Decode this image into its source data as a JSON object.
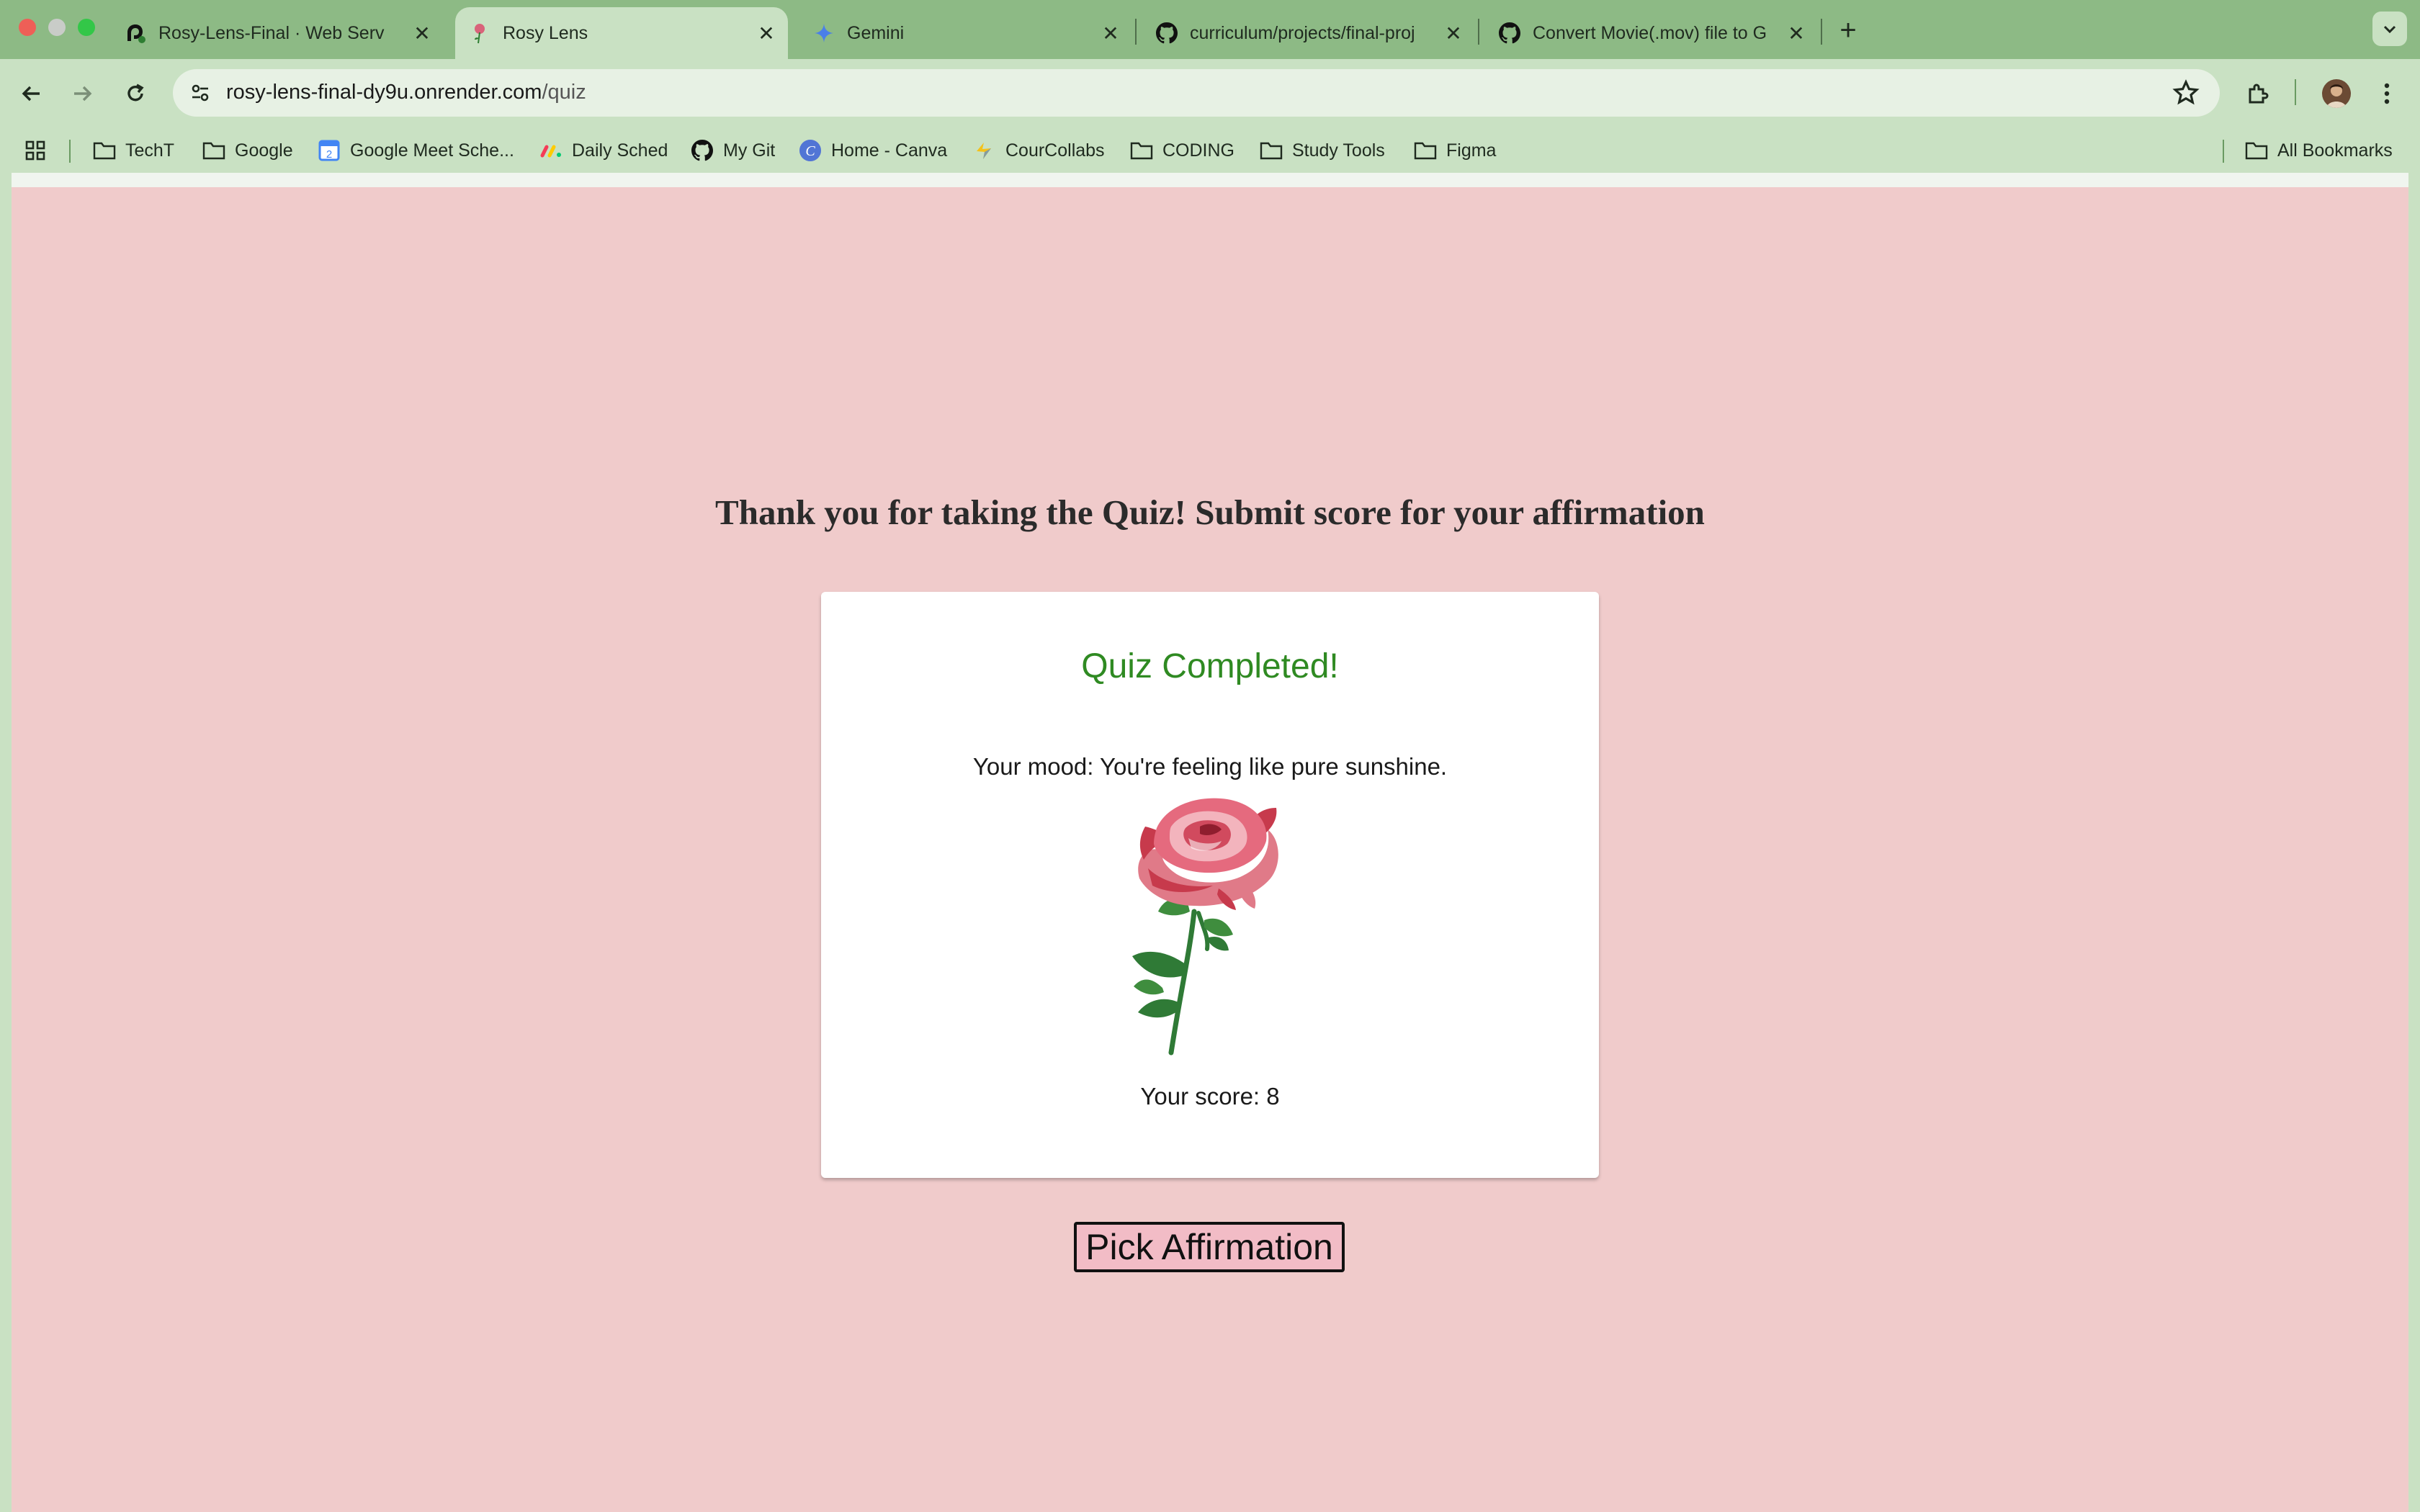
{
  "browser": {
    "tabs": [
      {
        "title": "Rosy-Lens-Final · Web Serv",
        "icon": "render-favicon-icon"
      },
      {
        "title": "Rosy Lens",
        "icon": "rose-favicon-icon",
        "active": true
      },
      {
        "title": "Gemini",
        "icon": "gemini-icon"
      },
      {
        "title": "curriculum/projects/final-proj",
        "icon": "github-icon"
      },
      {
        "title": "Convert Movie(.mov) file to G",
        "icon": "github-icon"
      }
    ],
    "url_host": "rosy-lens-final-dy9u.onrender.com",
    "url_path": "/quiz",
    "bookmarks": [
      {
        "label": "TechT",
        "icon": "folder-icon"
      },
      {
        "label": "Google",
        "icon": "folder-icon"
      },
      {
        "label": "Google Meet Sche...",
        "icon": "calendar-icon"
      },
      {
        "label": "Daily Sched",
        "icon": "monday-icon"
      },
      {
        "label": "My Git",
        "icon": "github-icon"
      },
      {
        "label": "Home - Canva",
        "icon": "canva-icon"
      },
      {
        "label": "CourCollabs",
        "icon": "lightning-icon"
      },
      {
        "label": "CODING",
        "icon": "folder-icon"
      },
      {
        "label": "Study Tools",
        "icon": "folder-icon"
      },
      {
        "label": "Figma",
        "icon": "folder-icon"
      }
    ],
    "all_bookmarks": "All Bookmarks"
  },
  "page": {
    "heading": "Thank you for taking the Quiz! Submit score for your affirmation",
    "card": {
      "title": "Quiz Completed!",
      "mood": "Your mood: You're feeling like pure sunshine.",
      "score": "Your score: 8"
    },
    "button_label": "Pick Affirmation"
  },
  "colors": {
    "page_background": "#f0cbcb",
    "browser_frame": "#8dba85",
    "toolbar": "#c9e1c3",
    "title_green": "#2f8a22",
    "button_background": "#f2bcc6"
  }
}
